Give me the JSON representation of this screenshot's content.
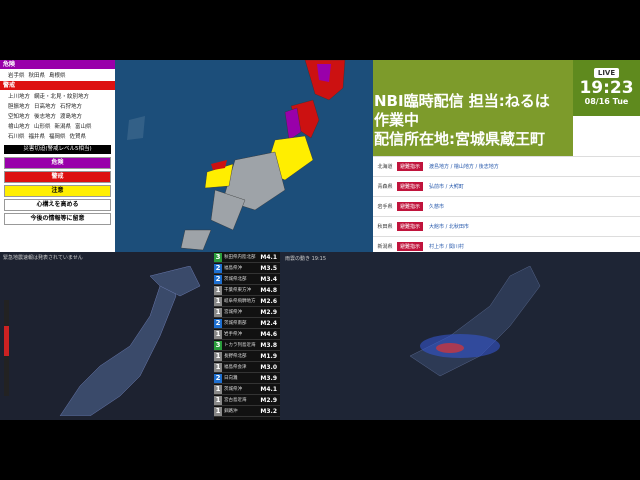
{
  "alert": {
    "danger_label": "危険",
    "danger_items": [
      "岩手県",
      "秋田県",
      "島根県"
    ],
    "warning_label": "警戒",
    "warning_items": [
      "上川地方",
      "網走・北見・紋別地方",
      "胆振地方",
      "日高地方",
      "石狩地方",
      "空知地方",
      "後志地方",
      "渡島地方",
      "檜山地方",
      "山形県",
      "新潟県",
      "富山県",
      "石川県",
      "福井県",
      "福岡県",
      "佐賀県"
    ],
    "section_title": "災害切迫(警戒レベル5相当)",
    "levels": [
      {
        "label": "危険",
        "color": "#9900aa"
      },
      {
        "label": "警戒",
        "color": "#dd1111"
      },
      {
        "label": "注意",
        "color": "#ffee00"
      },
      {
        "label": "心構えを高める",
        "color": "#ffffff"
      },
      {
        "label": "今後の情報等に留意",
        "color": "#ffffff"
      }
    ]
  },
  "stream": {
    "title_line1": "NBI臨時配信 担当:ねるは",
    "title_line2": "作業中",
    "title_line3": "配信所在地:宮城県蔵王町",
    "live": "LIVE",
    "time": "19:23",
    "date": "08/16 Tue"
  },
  "info_rows": [
    {
      "region": "北海道",
      "badge": "避難指示",
      "text": "渡島地方 / 檜山地方 / 後志地方"
    },
    {
      "region": "青森県",
      "badge": "避難指示",
      "text": "弘前市 / 大鰐町"
    },
    {
      "region": "岩手県",
      "badge": "避難指示",
      "text": "久慈市"
    },
    {
      "region": "秋田県",
      "badge": "避難指示",
      "text": "大館市 / 北秋田市"
    },
    {
      "region": "新潟県",
      "badge": "避難指示",
      "text": "村上市 / 関川村"
    }
  ],
  "left_map_label": "緊急地震速報は発表されていません",
  "quakes": [
    {
      "int": "3",
      "color": "#2a9d3c",
      "place": "秋田県内陸北部",
      "mag": "M4.1"
    },
    {
      "int": "2",
      "color": "#1e6fd0",
      "place": "福島県沖",
      "mag": "M3.5"
    },
    {
      "int": "2",
      "color": "#1e6fd0",
      "place": "茨城県北部",
      "mag": "M3.4"
    },
    {
      "int": "1",
      "color": "#888888",
      "place": "千葉県東方沖",
      "mag": "M4.8"
    },
    {
      "int": "1",
      "color": "#888888",
      "place": "岐阜県飛騨地方",
      "mag": "M2.6"
    },
    {
      "int": "1",
      "color": "#888888",
      "place": "宮城県沖",
      "mag": "M2.9"
    },
    {
      "int": "2",
      "color": "#1e6fd0",
      "place": "茨城県南部",
      "mag": "M2.4"
    },
    {
      "int": "1",
      "color": "#888888",
      "place": "岩手県沖",
      "mag": "M4.6"
    },
    {
      "int": "3",
      "color": "#2a9d3c",
      "place": "トカラ列島近海",
      "mag": "M3.8"
    },
    {
      "int": "1",
      "color": "#888888",
      "place": "長野県北部",
      "mag": "M1.9"
    },
    {
      "int": "1",
      "color": "#888888",
      "place": "福島県会津",
      "mag": "M3.0"
    },
    {
      "int": "2",
      "color": "#1e6fd0",
      "place": "日向灘",
      "mag": "M3.9"
    },
    {
      "int": "1",
      "color": "#888888",
      "place": "茨城県沖",
      "mag": "M4.1"
    },
    {
      "int": "1",
      "color": "#888888",
      "place": "宮古島近海",
      "mag": "M2.9"
    },
    {
      "int": "1",
      "color": "#888888",
      "place": "釧路沖",
      "mag": "M3.2"
    }
  ],
  "right_map_label": "雨雲の動き 19:15"
}
